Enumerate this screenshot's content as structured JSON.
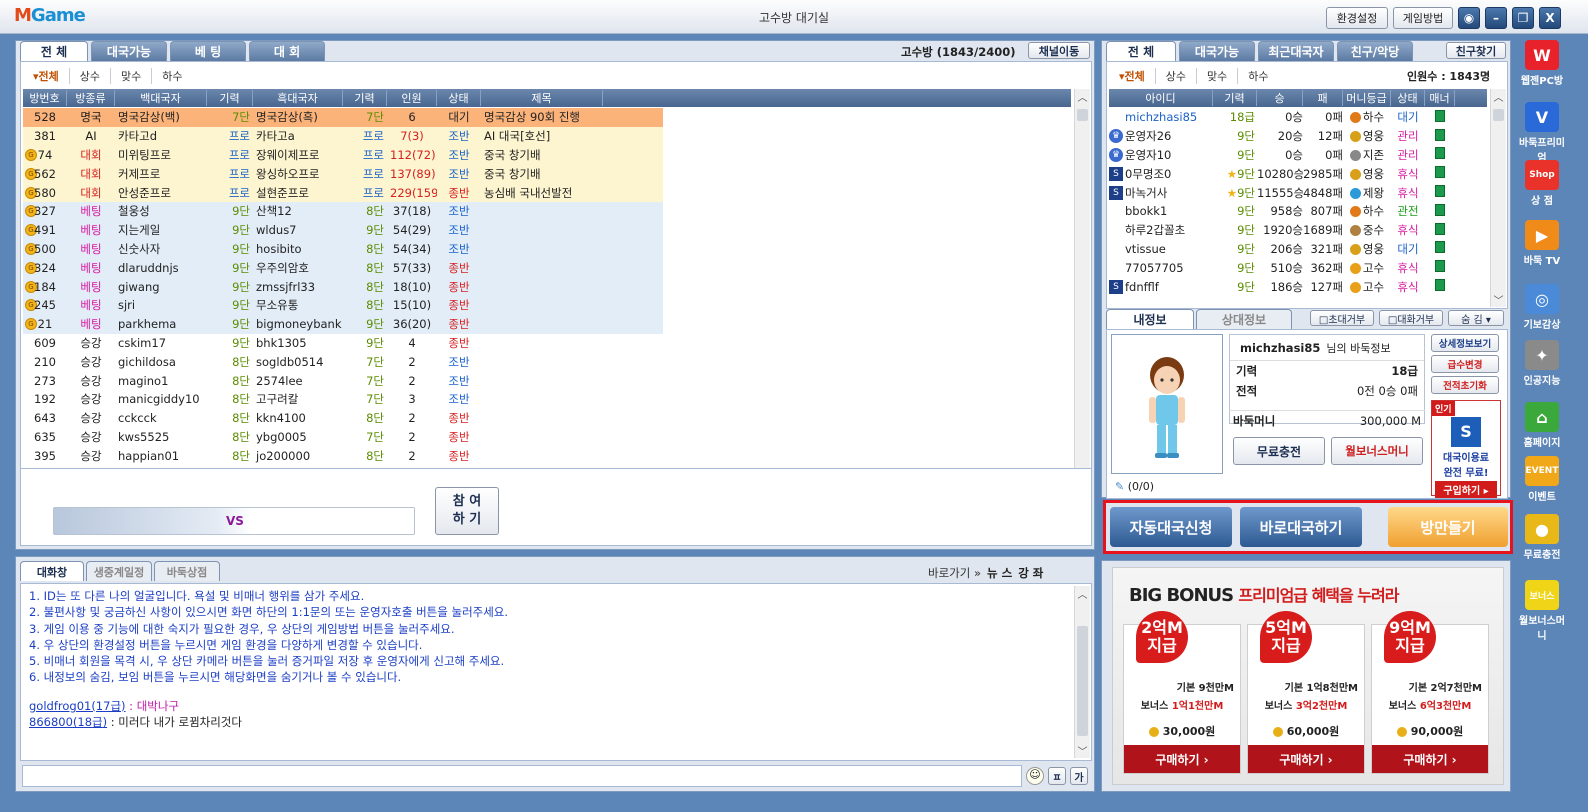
{
  "app": {
    "logo_a": "M",
    "logo_b": "Game",
    "title": "고수방 대기실",
    "settings": "환경설정",
    "howto": "게임방법",
    "camera_icon": "camera-icon",
    "min": "–",
    "max": "❐",
    "close": "X"
  },
  "left": {
    "tabs": [
      "전 체",
      "대국가능",
      "베 팅",
      "대 회"
    ],
    "room": "고수방 (1843/2400)",
    "channel_btn": "채널이동",
    "filters": [
      "▾전체",
      "상수",
      "맞수",
      "하수"
    ],
    "headers": [
      "방번호",
      "방종류",
      "백대국자",
      "기력",
      "흑대국자",
      "기력",
      "인원",
      "상태",
      "제목"
    ],
    "rows": [
      {
        "no": "528",
        "type": "명국",
        "white": "명국감상(백)",
        "wl": "7단",
        "black": "명국감상(흑)",
        "bl": "7단",
        "ppl": "6",
        "state": "대기",
        "title": "명국감상 90회 진행",
        "style": "sel",
        "coin": false
      },
      {
        "no": "381",
        "type": "AI",
        "white": "카타고d",
        "wl": "프로",
        "black": "카타고a",
        "bl": "프로",
        "ppl": "7(3)",
        "state": "조반",
        "title": "AI 대국[호선]",
        "style": "y",
        "coin": false
      },
      {
        "no": "74",
        "type": "대회",
        "white": "미위팅프로",
        "wl": "프로",
        "black": "장웨이제프로",
        "bl": "프로",
        "ppl": "112(72)",
        "state": "조반",
        "title": "중국 창기배",
        "style": "y",
        "coin": true
      },
      {
        "no": "562",
        "type": "대회",
        "white": "커제프로",
        "wl": "프로",
        "black": "왕싱하오프로",
        "bl": "프로",
        "ppl": "137(89)",
        "state": "조반",
        "title": "중국 창기배",
        "style": "y",
        "coin": true
      },
      {
        "no": "580",
        "type": "대회",
        "white": "안성준프로",
        "wl": "프로",
        "black": "설현준프로",
        "bl": "프로",
        "ppl": "229(159)",
        "state": "종반",
        "title": "농심배 국내선발전",
        "style": "y",
        "coin": true
      },
      {
        "no": "327",
        "type": "베팅",
        "white": "철웅성",
        "wl": "9단",
        "black": "산책12",
        "bl": "8단",
        "ppl": "37(18)",
        "state": "조반",
        "title": "",
        "style": "b",
        "coin": true
      },
      {
        "no": "491",
        "type": "베팅",
        "white": "지는게일",
        "wl": "9단",
        "black": "wldus7",
        "bl": "9단",
        "ppl": "54(29)",
        "state": "조반",
        "title": "",
        "style": "b",
        "coin": true
      },
      {
        "no": "500",
        "type": "베팅",
        "white": "신숫사자",
        "wl": "9단",
        "black": "hosibito",
        "bl": "8단",
        "ppl": "54(34)",
        "state": "조반",
        "title": "",
        "style": "b",
        "coin": true
      },
      {
        "no": "324",
        "type": "베팅",
        "white": "dlaruddnjs",
        "wl": "9단",
        "black": "우주의암호",
        "bl": "8단",
        "ppl": "57(33)",
        "state": "종반",
        "title": "",
        "style": "b",
        "coin": true
      },
      {
        "no": "184",
        "type": "베팅",
        "white": "giwang",
        "wl": "9단",
        "black": "zmssjfrl33",
        "bl": "8단",
        "ppl": "18(10)",
        "state": "종반",
        "title": "",
        "style": "b",
        "coin": true
      },
      {
        "no": "245",
        "type": "베팅",
        "white": "sjri",
        "wl": "9단",
        "black": "무소유통",
        "bl": "8단",
        "ppl": "15(10)",
        "state": "종반",
        "title": "",
        "style": "b",
        "coin": true
      },
      {
        "no": "21",
        "type": "베팅",
        "white": "parkhema",
        "wl": "9단",
        "black": "bigmoneybank",
        "bl": "9단",
        "ppl": "36(20)",
        "state": "종반",
        "title": "",
        "style": "b",
        "coin": true
      },
      {
        "no": "609",
        "type": "승강",
        "white": "cskim17",
        "wl": "9단",
        "black": "bhk1305",
        "bl": "9단",
        "ppl": "4",
        "state": "종반",
        "title": "",
        "style": "w",
        "coin": false
      },
      {
        "no": "210",
        "type": "승강",
        "white": "gichildosa",
        "wl": "8단",
        "black": "sogldb0514",
        "bl": "7단",
        "ppl": "2",
        "state": "조반",
        "title": "",
        "style": "w",
        "coin": false
      },
      {
        "no": "273",
        "type": "승강",
        "white": "magino1",
        "wl": "8단",
        "black": "2574lee",
        "bl": "7단",
        "ppl": "2",
        "state": "조반",
        "title": "",
        "style": "w",
        "coin": false
      },
      {
        "no": "192",
        "type": "승강",
        "white": "manicgiddy10",
        "wl": "8단",
        "black": "고구려칼",
        "bl": "7단",
        "ppl": "3",
        "state": "조반",
        "title": "",
        "style": "w",
        "coin": false
      },
      {
        "no": "643",
        "type": "승강",
        "white": "cckcck",
        "wl": "8단",
        "black": "kkn4100",
        "bl": "8단",
        "ppl": "2",
        "state": "종반",
        "title": "",
        "style": "w",
        "coin": false
      },
      {
        "no": "635",
        "type": "승강",
        "white": "kws5525",
        "wl": "8단",
        "black": "ybg0005",
        "bl": "7단",
        "ppl": "2",
        "state": "종반",
        "title": "",
        "style": "w",
        "coin": false
      },
      {
        "no": "395",
        "type": "승강",
        "white": "happian01",
        "wl": "8단",
        "black": "jo200000",
        "bl": "8단",
        "ppl": "2",
        "state": "종반",
        "title": "",
        "style": "w",
        "coin": false
      }
    ],
    "vs": "VS",
    "join": "참 여\n하 기"
  },
  "chat": {
    "tabs": [
      "대화창",
      "생중계일정",
      "바둑상점"
    ],
    "links": [
      "바로가기 »",
      "뉴 스",
      "강 좌"
    ],
    "notices": [
      "1. ID는 또 다른 나의 얼굴입니다. 욕설 및 비매너 행위를 삼가 주세요.",
      "2. 불편사항 및 궁금하신 사항이 있으시면 화면 하단의 1:1문의 또는 운영자호출 버튼을 눌러주세요.",
      "3. 게임 이용 중 기능에 대한 숙지가 필요한 경우, 우 상단의 게임방법 버튼을 눌러주세요.",
      "4. 우 상단의 환경설정 버튼을 누르시면 게임 환경을 다양하게 변경할 수 있습니다.",
      "5. 비매너 회원을 목격 시, 우 상단 카메라 버튼을 눌러 증거파일 저장 후 운영자에게 신고해 주세요.",
      "6. 내정보의 숨김, 보임 버튼을 누르시면 해당화면을 숨기거나 볼 수 있습니다."
    ],
    "messages": [
      {
        "user": "goldfrog01(17급)",
        "text": " : 대박나구",
        "color": "#c21aa8"
      },
      {
        "user": "866800(18급)",
        "text": " : 미러다 내가 로뀜차리것다",
        "color": "#222"
      }
    ]
  },
  "right": {
    "tabs": [
      "전 체",
      "대국가능",
      "최근대국자",
      "친구/악당"
    ],
    "find_btn": "친구찾기",
    "filters": [
      "▾전체",
      "상수",
      "맞수",
      "하수"
    ],
    "count": "인원수 : 1843명",
    "headers": [
      "아이디",
      "기력",
      "승",
      "패",
      "머니등급",
      "상태",
      "매너"
    ],
    "users": [
      {
        "id": "michzhasi85",
        "lv": "18급",
        "win": "0승",
        "lose": "0패",
        "grade": "하수",
        "state": "대기",
        "icon": "",
        "sel": true
      },
      {
        "id": "운영자26",
        "lv": "9단",
        "win": "20승",
        "lose": "12패",
        "grade": "영웅",
        "state": "관리",
        "icon": "admin"
      },
      {
        "id": "운영자10",
        "lv": "9단",
        "win": "0승",
        "lose": "0패",
        "grade": "지존",
        "state": "관리",
        "icon": "admin"
      },
      {
        "id": "0무명조0",
        "lv": "9단",
        "win": "10280승",
        "lose": "2985패",
        "grade": "영웅",
        "state": "휴식",
        "icon": "s",
        "star": true
      },
      {
        "id": "마녹거사",
        "lv": "9단",
        "win": "11555승",
        "lose": "4848패",
        "grade": "제왕",
        "state": "휴식",
        "icon": "s",
        "star": true
      },
      {
        "id": "bbokk1",
        "lv": "9단",
        "win": "958승",
        "lose": "807패",
        "grade": "하수",
        "state": "관전",
        "icon": ""
      },
      {
        "id": "하루2갑꼴초",
        "lv": "9단",
        "win": "1920승",
        "lose": "1689패",
        "grade": "중수",
        "state": "휴식",
        "icon": ""
      },
      {
        "id": "vtissue",
        "lv": "9단",
        "win": "206승",
        "lose": "321패",
        "grade": "영웅",
        "state": "대기",
        "icon": ""
      },
      {
        "id": "77057705",
        "lv": "9단",
        "win": "510승",
        "lose": "362패",
        "grade": "고수",
        "state": "휴식",
        "icon": ""
      },
      {
        "id": "fdnfflf",
        "lv": "9단",
        "win": "186승",
        "lose": "127패",
        "grade": "고수",
        "state": "휴식",
        "icon": "s"
      }
    ],
    "info_tabs": [
      "내정보",
      "상대정보"
    ],
    "chk1": "□초대거부",
    "chk2": "□대화거부",
    "hide": "숨 김 ▾",
    "profile": {
      "name": "michzhasi85",
      "suffix": "님의 바둑정보",
      "lv_label": "기력",
      "lv": "18급",
      "rec_label": "전적",
      "rec": "0전 0승 0패",
      "money_label": "바둑머니",
      "money": "300,000 M",
      "free": "무료충전",
      "bonus": "월보너스머니",
      "heart": "(0/0)"
    },
    "side_btns": [
      "상세정보보기",
      "급수변경",
      "전적초기화"
    ],
    "promo": {
      "hot": "인기",
      "l1": "대국이용료",
      "l2": "완전 무료!",
      "buy": "구입하기 ▸"
    },
    "actions": [
      "자동대국신청",
      "바로대국하기",
      "방만들기"
    ],
    "ad": {
      "title_a": "BIG BONUS",
      "title_b": "프리미엄급 혜택을 누려라",
      "boxes": [
        {
          "badge": "2억M\n지급",
          "base": "기본 9천만M",
          "bonus_l": "보너스 ",
          "bonus_v": "1억1천만M",
          "price": "30,000원",
          "buy": "구매하기  ›"
        },
        {
          "badge": "5억M\n지급",
          "base": "기본 1억8천만M",
          "bonus_l": "보너스 ",
          "bonus_v": "3억2천만M",
          "price": "60,000원",
          "buy": "구매하기  ›"
        },
        {
          "badge": "9억M\n지급",
          "base": "기본 2억7천만M",
          "bonus_l": "보너스 ",
          "bonus_v": "6억3천만M",
          "price": "90,000원",
          "buy": "구매하기  ›"
        }
      ]
    }
  },
  "sidebar": [
    {
      "label": "웹젠PC방",
      "icon": "W",
      "color": "#e8222a"
    },
    {
      "label": "바둑프리미엄",
      "icon": "V",
      "color": "#2a6ad8"
    },
    {
      "label": "상 점",
      "icon": "Shop",
      "color": "#e8322a"
    },
    {
      "label": "바둑 TV",
      "icon": "▶",
      "color": "#f08a18"
    },
    {
      "label": "기보감상",
      "icon": "◎",
      "color": "#4a8ad8"
    },
    {
      "label": "인공지능",
      "icon": "✦",
      "color": "#8a8a8a"
    },
    {
      "label": "홈페이지",
      "icon": "⌂",
      "color": "#3aa83a"
    },
    {
      "label": "이벤트",
      "icon": "EVENT",
      "color": "#f0a818"
    },
    {
      "label": "무료충전",
      "icon": "●",
      "color": "#e8b818"
    },
    {
      "label": "월보너스머니",
      "icon": "보너스",
      "color": "#f0d418"
    }
  ]
}
